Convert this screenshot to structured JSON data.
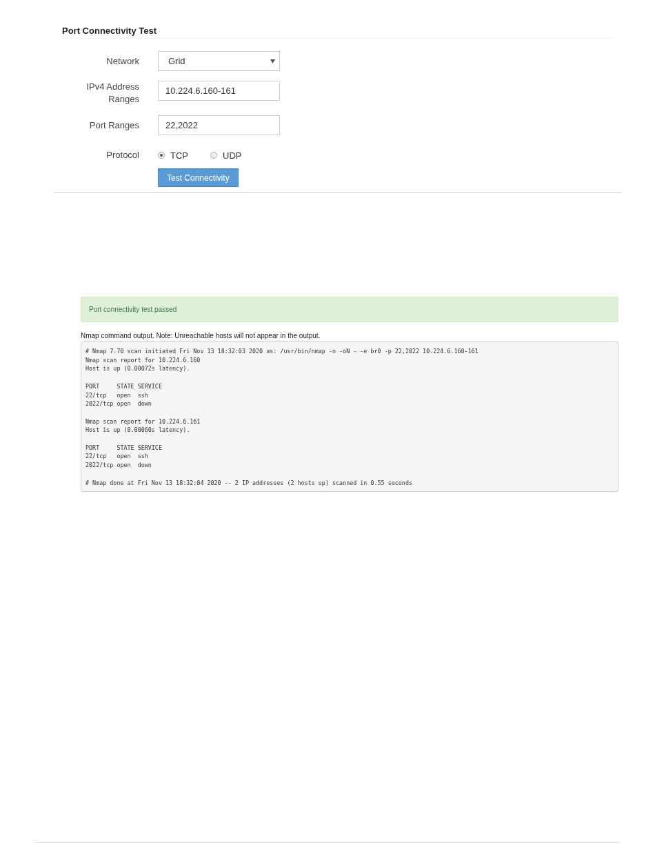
{
  "form": {
    "title": "Port Connectivity Test",
    "network": {
      "label": "Network",
      "value": "Grid"
    },
    "ipv4": {
      "label": "IPv4 Address Ranges",
      "value": "10.224.6.160-161"
    },
    "ports": {
      "label": "Port Ranges",
      "value": "22,2022"
    },
    "protocol": {
      "label": "Protocol",
      "options": [
        {
          "label": "TCP",
          "selected": true
        },
        {
          "label": "UDP",
          "selected": false
        }
      ]
    },
    "button": "Test Connectivity"
  },
  "result": {
    "alert": "Port connectivity test passed",
    "note": "Nmap command output. Note: Unreachable hosts will not appear in the output.",
    "output": "# Nmap 7.70 scan initiated Fri Nov 13 18:32:03 2020 as: /usr/bin/nmap -n -oN - -e br0 -p 22,2022 10.224.6.160-161\nNmap scan report for 10.224.6.160\nHost is up (0.00072s latency).\n\nPORT     STATE SERVICE\n22/tcp   open  ssh\n2022/tcp open  down\n\nNmap scan report for 10.224.6.161\nHost is up (0.00060s latency).\n\nPORT     STATE SERVICE\n22/tcp   open  ssh\n2022/tcp open  down\n\n# Nmap done at Fri Nov 13 18:32:04 2020 -- 2 IP addresses (2 hosts up) scanned in 0.55 seconds"
  }
}
